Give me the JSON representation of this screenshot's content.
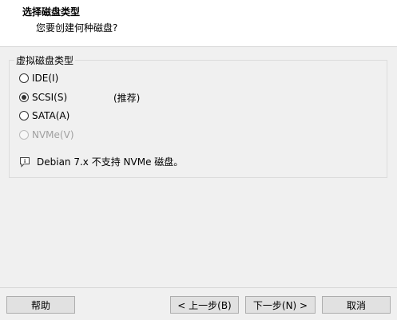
{
  "header": {
    "title": "选择磁盘类型",
    "subtitle": "您要创建何种磁盘?"
  },
  "group": {
    "legend": "虚拟磁盘类型",
    "options": [
      {
        "label": "IDE(I)",
        "checked": false,
        "disabled": false
      },
      {
        "label": "SCSI(S)",
        "checked": true,
        "disabled": false,
        "note": "(推荐)"
      },
      {
        "label": "SATA(A)",
        "checked": false,
        "disabled": false
      },
      {
        "label": "NVMe(V)",
        "checked": false,
        "disabled": true
      }
    ],
    "info": {
      "icon": "info-icon",
      "text": "Debian 7.x 不支持 NVMe 磁盘。"
    }
  },
  "buttons": {
    "help": "帮助",
    "prev": "< 上一步(B)",
    "next": "下一步(N) >",
    "cancel": "取消"
  }
}
